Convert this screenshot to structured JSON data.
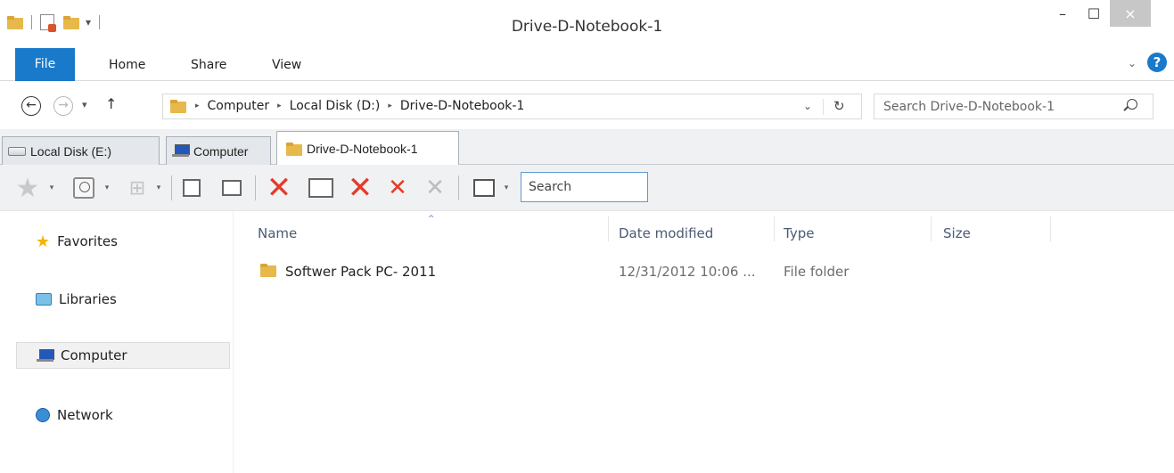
{
  "window": {
    "title": "Drive-D-Notebook-1",
    "close_symbol": "×",
    "minimize_symbol": "–",
    "maximize_symbol": "☐"
  },
  "quick_access": {
    "dropdown_symbol": "▾"
  },
  "ribbon": {
    "tabs": [
      "File",
      "Home",
      "Share",
      "View"
    ],
    "expand_symbol": "⌄",
    "help_symbol": "?"
  },
  "address": {
    "breadcrumbs": [
      "Computer",
      "Local Disk (D:)",
      "Drive-D-Notebook-1"
    ],
    "separator": "▸",
    "dropdown_symbol": "⌄",
    "refresh_symbol": "↻"
  },
  "search": {
    "placeholder": "Search Drive-D-Notebook-1"
  },
  "nav_buttons": {
    "back": "←",
    "forward": "→",
    "recent": "▾",
    "up": "↑"
  },
  "folder_tabs": [
    {
      "label": "Local Disk (E:)",
      "icon": "drive-icon"
    },
    {
      "label": "Computer",
      "icon": "computer-icon"
    },
    {
      "label": "Drive-D-Notebook-1",
      "icon": "folder-icon",
      "active": true
    }
  ],
  "toolbar": {
    "search_placeholder": "Search",
    "dropdown_symbol": "▾",
    "star_symbol": "★",
    "win_symbol": "⊞",
    "delete_symbol": "✕"
  },
  "navigation": {
    "items": [
      "Favorites",
      "Libraries",
      "Computer",
      "Network"
    ],
    "selected": "Computer",
    "star_symbol": "★"
  },
  "file_list": {
    "columns": [
      "Name",
      "Date modified",
      "Type",
      "Size"
    ],
    "sort_symbol": "^",
    "rows": [
      {
        "name": "Softwer Pack PC- 2011",
        "date_modified": "12/31/2012 10:06 ...",
        "type": "File folder",
        "size": ""
      }
    ]
  },
  "colors": {
    "accent": "#1979ca",
    "folder": "#e7b94a",
    "delete_red": "#e53a2a"
  }
}
